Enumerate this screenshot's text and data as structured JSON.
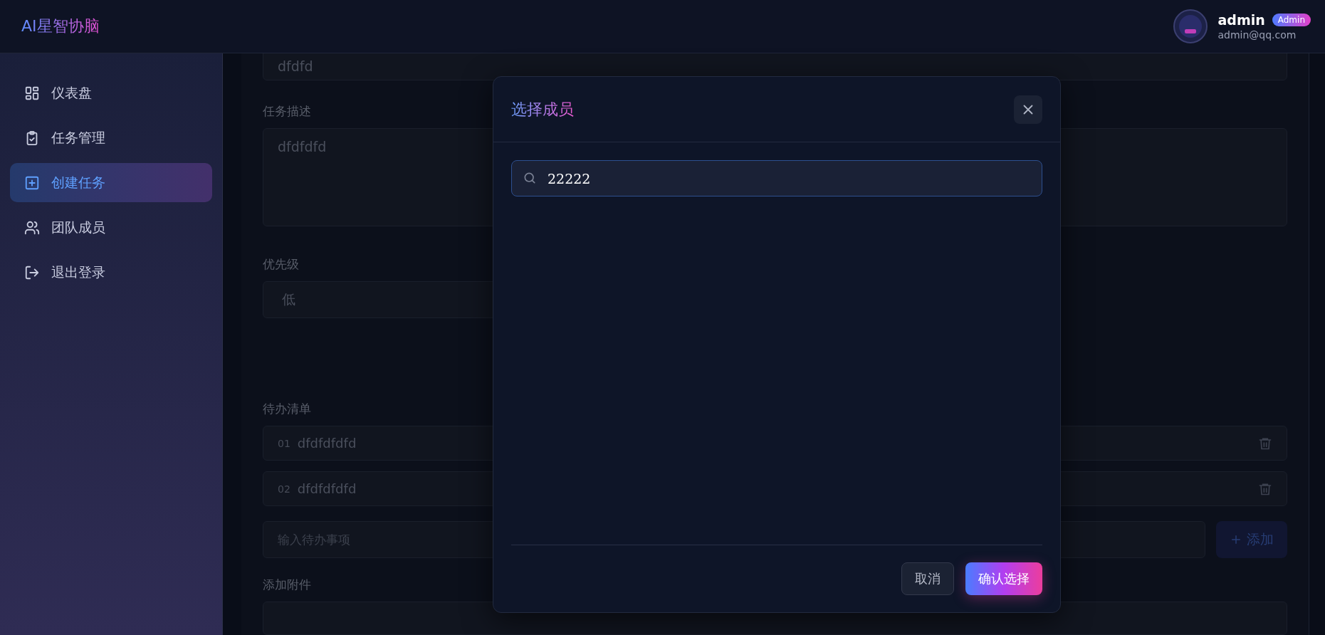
{
  "header": {
    "logo": "AI星智协脑",
    "user": {
      "name": "admin",
      "badge": "Admin",
      "email": "admin@qq.com"
    }
  },
  "sidebar": {
    "items": [
      {
        "label": "仪表盘",
        "selected": false
      },
      {
        "label": "任务管理",
        "selected": false
      },
      {
        "label": "创建任务",
        "selected": true
      },
      {
        "label": "团队成员",
        "selected": false
      },
      {
        "label": "退出登录",
        "selected": false
      }
    ]
  },
  "form": {
    "title_value": "dfdfd",
    "description": {
      "label": "任务描述",
      "value": "dfdfdfd"
    },
    "priority": {
      "label": "优先级",
      "value": "低"
    },
    "todos": {
      "label": "待办清单",
      "items": [
        {
          "index": "01",
          "text": "dfdfdfdfd"
        },
        {
          "index": "02",
          "text": "dfdfdfdfd"
        }
      ],
      "input_placeholder": "输入待办事项",
      "add_label": "添加"
    },
    "attachments": {
      "label": "添加附件"
    }
  },
  "dialog": {
    "title": "选择成员",
    "search": {
      "value": "22222"
    },
    "buttons": [
      {
        "label": "取消",
        "kind": "secondary"
      },
      {
        "label": "确认选择",
        "kind": "primary"
      }
    ]
  }
}
